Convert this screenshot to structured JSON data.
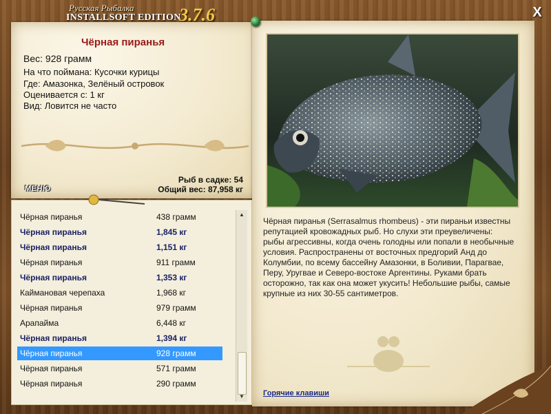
{
  "app": {
    "title_top": "Русская Рыбалка",
    "title_bottom": "INSTALLSOFT EDITION",
    "version": "3.7.6"
  },
  "window": {
    "close_label": "X"
  },
  "fish": {
    "name": "Чёрная пиранья",
    "weight": "Вес: 928 грамм",
    "bait": "На что поймана: Кусочки курицы",
    "location": "Где: Амазонка, Зелёный островок",
    "value_from": "Оценивается с: 1 кг",
    "frequency": "Вид: Ловится не часто"
  },
  "stats": {
    "fish_in_keepnet": "Рыб в садке: 54",
    "total_weight": "Общий вес: 87,958 кг"
  },
  "menu_label": "МЕНЮ",
  "description": "Чёрная пиранья (Serrasalmus rhombeus) - эти пираньи известны репутацией кровожадных рыб. Но слухи эти преувеличены: рыбы агрессивны, когда очень голодны или попали в необычные условия. Распространены от восточных предгорий Анд до Колумбии, по всему бассейну Амазонки, в Боливии, Парагвае, Перу, Уругвае и Северо-востоке Аргентины. Руками брать осторожно, так как она может укусить! Небольшие рыбы, самые крупные из них 30-55 сантиметров.",
  "hotkeys_label": "Горячие клавиши",
  "catch_list": [
    {
      "name": "Чёрная пиранья",
      "weight": "438 грамм",
      "bold": false,
      "selected": false
    },
    {
      "name": "Чёрная пиранья",
      "weight": "1,845 кг",
      "bold": true,
      "selected": false
    },
    {
      "name": "Чёрная пиранья",
      "weight": "1,151 кг",
      "bold": true,
      "selected": false
    },
    {
      "name": "Чёрная пиранья",
      "weight": "911 грамм",
      "bold": false,
      "selected": false
    },
    {
      "name": "Чёрная пиранья",
      "weight": "1,353 кг",
      "bold": true,
      "selected": false
    },
    {
      "name": "Каймановая черепаха",
      "weight": "1,968 кг",
      "bold": false,
      "selected": false
    },
    {
      "name": "Чёрная пиранья",
      "weight": "979 грамм",
      "bold": false,
      "selected": false
    },
    {
      "name": "Арапайма",
      "weight": "6,448 кг",
      "bold": false,
      "selected": false
    },
    {
      "name": "Чёрная пиранья",
      "weight": "1,394 кг",
      "bold": true,
      "selected": false
    },
    {
      "name": "Чёрная пиранья",
      "weight": "928 грамм",
      "bold": false,
      "selected": true
    },
    {
      "name": "Чёрная пиранья",
      "weight": "571 грамм",
      "bold": false,
      "selected": false
    },
    {
      "name": "Чёрная пиранья",
      "weight": "290 грамм",
      "bold": false,
      "selected": false
    }
  ],
  "colors": {
    "fish_name": "#9a1a1a",
    "selection": "#3399ff",
    "bold_entry": "#1a2266",
    "version": "#f2c94a"
  }
}
